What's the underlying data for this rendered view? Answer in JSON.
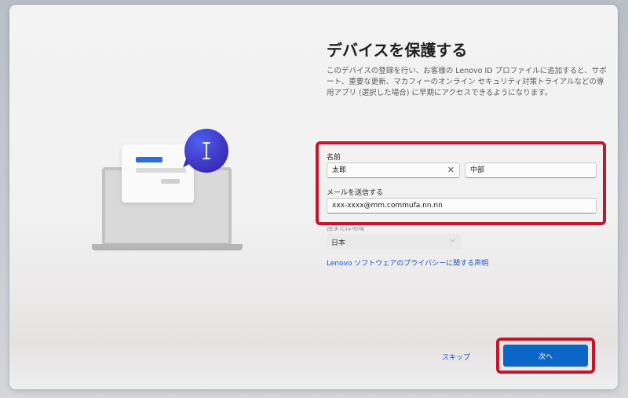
{
  "page": {
    "title": "デバイスを保護する",
    "description": "このデバイスの登録を行い、お客様の Lenovo ID プロファイルに追加すると、サポート、重要な更新、マカフィーのオンライン セキュリティ対策トライアルなどの専用アプリ (選択した場合) に早期にアクセスできるようになります。"
  },
  "form": {
    "name_label": "名前",
    "first_name_value": "太郎",
    "last_name_value": "中部",
    "email_label": "メールを送信する",
    "email_value": "xxx-xxxx@mm.commufa.nn.nn",
    "region_label": "国または地域",
    "region_value": "日本",
    "privacy_link": "Lenovo ソフトウェアのプライバシーに関する声明"
  },
  "actions": {
    "skip_label": "スキップ",
    "next_label": "次へ"
  },
  "icons": {
    "clear": "close-icon",
    "dropdown": "chevron-down-icon",
    "cursor": "text-cursor-icon"
  },
  "colors": {
    "accent": "#0a67c8",
    "highlight": "#c4162a",
    "link": "#1a55b8"
  }
}
